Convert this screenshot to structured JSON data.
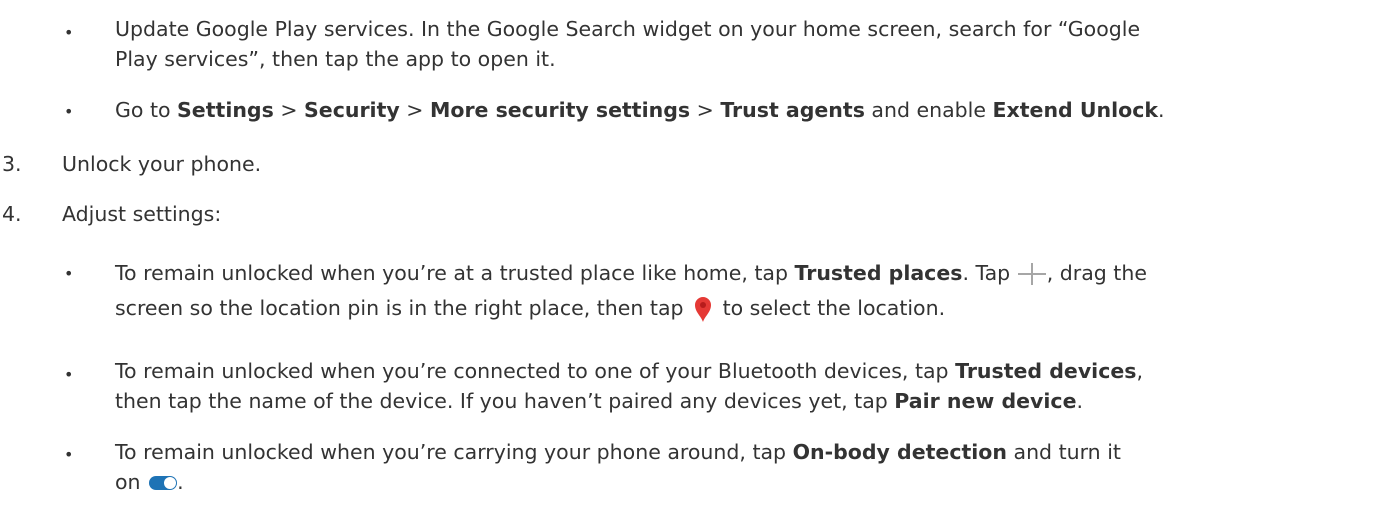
{
  "bullets_top": [
    {
      "line1": "Update Google Play services. In the Google Search widget on your home screen, search for “Google",
      "line2": "Play services”, then tap the app to open it."
    }
  ],
  "settings_path": {
    "prefix": "Go to ",
    "settings": "Settings",
    "sep1": " > ",
    "security": "Security",
    "sep2": " > ",
    "more": "More security settings",
    "sep3": " > ",
    "trust": "Trust agents",
    "middle": " and enable ",
    "extend": "Extend Unlock",
    "end": "."
  },
  "steps": [
    {
      "number": "3.",
      "text": "Unlock your phone."
    },
    {
      "number": "4.",
      "text": "Adjust settings:"
    }
  ],
  "trusted_places": {
    "prefix": "To remain unlocked when you’re at a trusted place like home, tap ",
    "bold": "Trusted places",
    "mid": ". Tap ",
    "after_plus": ", drag the",
    "line2_prefix": "screen so the location pin is in the right place, then tap ",
    "line2_suffix": " to select the location."
  },
  "trusted_devices": {
    "prefix": "To remain unlocked when you’re connected to one of your Bluetooth devices, tap ",
    "bold": "Trusted devices",
    "comma": ",",
    "line2_prefix": "then tap the name of the device. If you haven’t paired any devices yet, tap ",
    "bold2": "Pair new device",
    "end": "."
  },
  "on_body": {
    "prefix": "To remain unlocked when you’re carrying your phone around, tap ",
    "bold": "On-body detection",
    "suffix": " and turn it",
    "line2_prefix": "on ",
    "end": "."
  },
  "icons": {
    "bullet": "•",
    "plus": "plus-icon",
    "pin": "location-pin-icon",
    "toggle": "toggle-on-icon"
  },
  "colors": {
    "text": "#333333",
    "plus": "#a6a6a6",
    "pin": "#e53935",
    "toggle": "#1e73b5"
  }
}
